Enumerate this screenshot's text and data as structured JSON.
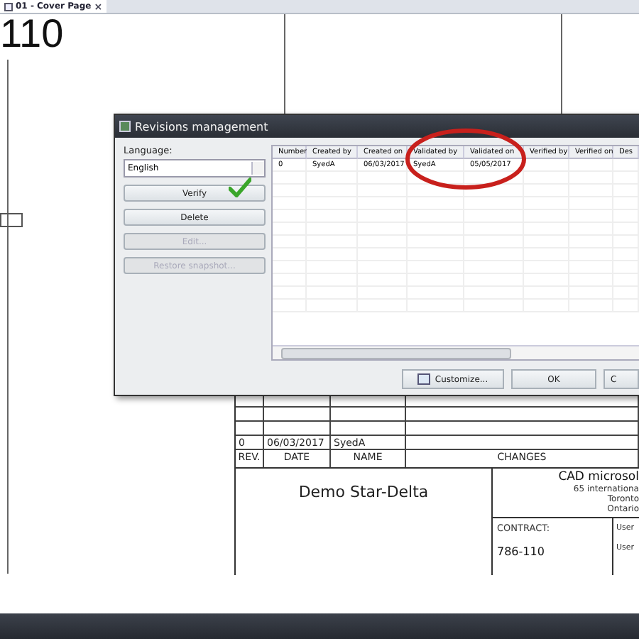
{
  "tab_bar": {
    "tabs": [
      {
        "label": "01 - Cover Page",
        "selected": true,
        "close": "×"
      }
    ]
  },
  "sheet": {
    "number": "110",
    "title_block": {
      "revision_rows": [
        {
          "rev": "0",
          "date": "06/03/2017",
          "name": "SyedA"
        }
      ],
      "headers": [
        "REV.",
        "DATE",
        "NAME",
        "CHANGES"
      ],
      "project_title": "Demo Star-Delta",
      "company_lines": [
        "CAD microsol",
        "65 internationa",
        "Toronto",
        "Ontario"
      ],
      "contract_label": "CONTRACT:",
      "contract_number": "786-110",
      "user_labels": [
        "User",
        "User"
      ]
    }
  },
  "dialog": {
    "title": "Revisions management",
    "language_label": "Language:",
    "language_value": "English",
    "buttons": [
      {
        "label": "Verify",
        "disabled": false,
        "verified": true
      },
      {
        "label": "Delete",
        "disabled": false,
        "verified": false
      },
      {
        "label": "Edit...",
        "disabled": true,
        "verified": false
      },
      {
        "label": "Restore snapshot...",
        "disabled": true,
        "verified": false
      }
    ],
    "table": {
      "columns": [
        "Number",
        "Created by",
        "Created on",
        "Validated by",
        "Validated on",
        "Verified by",
        "Verified on",
        "Des"
      ],
      "rows": [
        [
          "0",
          "SyedA",
          "06/03/2017",
          "SyedA",
          "05/05/2017"
        ]
      ]
    },
    "footer_buttons": [
      {
        "label": "Customize...",
        "kind": "icon"
      },
      {
        "label": "OK",
        "kind": "plain"
      },
      {
        "label": "C",
        "kind": "plain"
      }
    ]
  }
}
